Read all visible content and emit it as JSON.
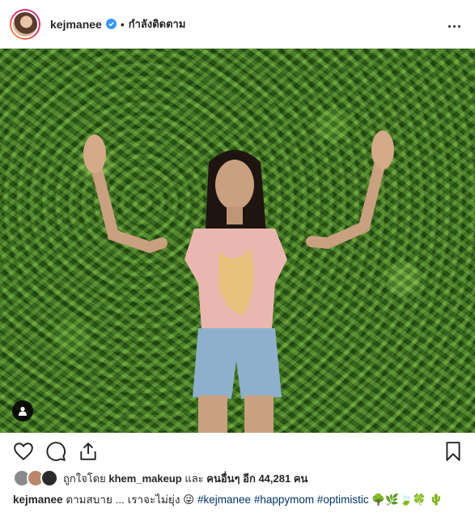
{
  "header": {
    "username": "kejmanee",
    "separator": "•",
    "follow_status": "กำลังติดตาม",
    "more_label": "..."
  },
  "likes": {
    "prefix": "ถูกใจโดย",
    "first_liker": "khem_makeup",
    "middle": "และ",
    "others_label": "คนอื่นๆ อีก 44,281 คน"
  },
  "caption": {
    "username": "kejmanee",
    "text": "ตามสบาย ... เราจะไม่ยุ่ง 😜",
    "hashtags": [
      "#kejmanee",
      "#happymom",
      "#optimistic"
    ],
    "emojis_inline": "🌳🌿🍃🍀",
    "emojis_wrap": "🌵"
  },
  "icons": {
    "like": "heart-icon",
    "comment": "comment-icon",
    "share": "share-icon",
    "save": "bookmark-icon",
    "verified": "verified-badge-icon",
    "user_tag": "user-tag-icon"
  },
  "colors": {
    "verified": "#3897f0",
    "hashtag": "#003569"
  }
}
